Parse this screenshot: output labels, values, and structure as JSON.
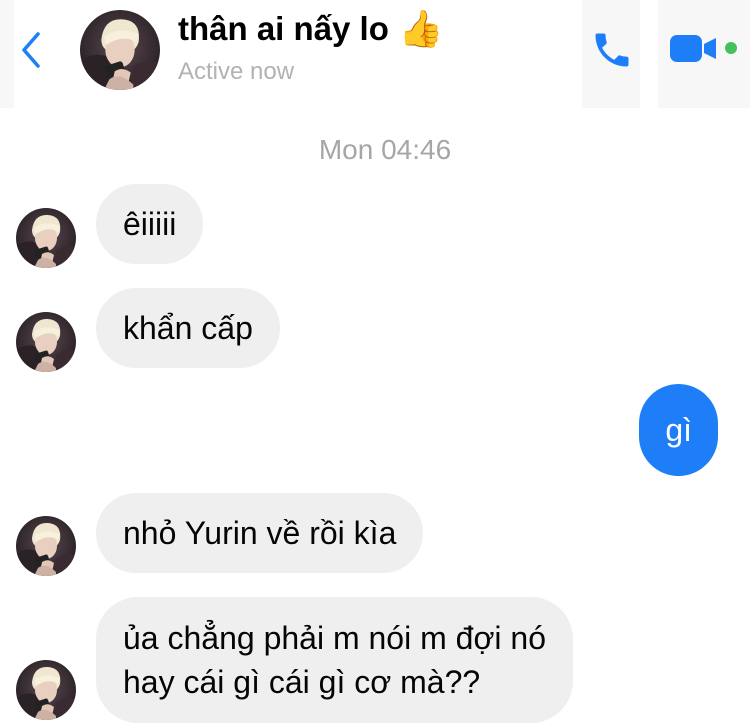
{
  "header": {
    "back_icon": "chevron-left-icon",
    "contact_name": "thân ai nấy lo",
    "name_emoji": "👍",
    "status": "Active now",
    "call_icon": "phone-icon",
    "video_icon": "video-camera-icon",
    "accent_color": "#1e7ef7",
    "online_color": "#44c15b"
  },
  "conversation": {
    "timestamp": "Mon 04:46",
    "messages": [
      {
        "direction": "incoming",
        "text": "êiiiii"
      },
      {
        "direction": "incoming",
        "text": "khẩn cấp"
      },
      {
        "direction": "outgoing",
        "text": "gì"
      },
      {
        "direction": "incoming",
        "text": "nhỏ Yurin về rồi kìa"
      },
      {
        "direction": "incoming",
        "lines": [
          "ủa chẳng phải m nói m đợi nó",
          "hay cái gì cái gì cơ mà??"
        ]
      }
    ]
  },
  "colors": {
    "incoming_bubble": "#efefef",
    "outgoing_bubble": "#1e7ef7",
    "secondary_text": "#a6a6a6"
  }
}
